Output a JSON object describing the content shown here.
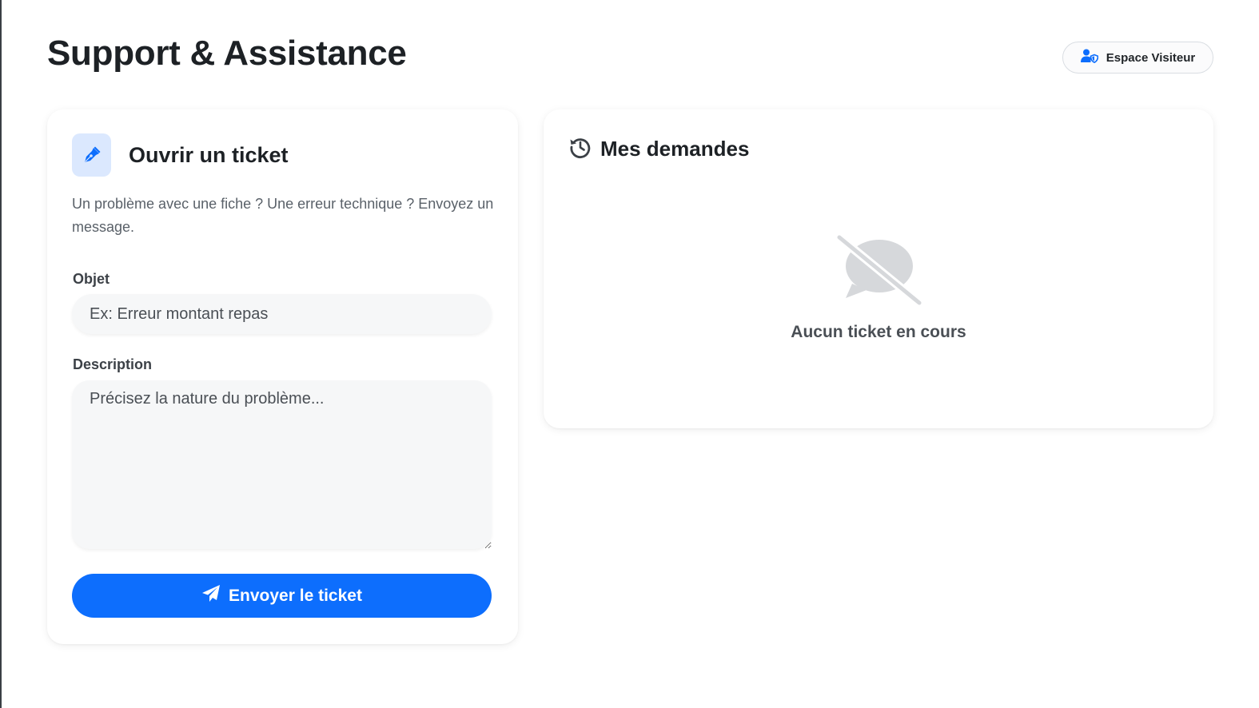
{
  "header": {
    "title": "Support & Assistance",
    "visitor_button": "Espace Visiteur"
  },
  "form": {
    "title": "Ouvrir un ticket",
    "description": "Un problème avec une fiche ? Une erreur technique ? Envoyez un message.",
    "subject_label": "Objet",
    "subject_placeholder": "Ex: Erreur montant repas",
    "subject_value": "",
    "description_label": "Description",
    "description_placeholder": "Précisez la nature du problème...",
    "description_value": "",
    "submit_label": "Envoyer le ticket"
  },
  "requests": {
    "title": "Mes demandes",
    "empty_text": "Aucun ticket en cours"
  },
  "colors": {
    "accent": "#0d6efd",
    "icon_bg": "#dbe8fe",
    "empty_icon": "#d6d8db"
  },
  "icons": {
    "visitor": "user-shield-icon",
    "form": "pen-nib-icon",
    "submit": "paper-plane-icon",
    "history": "history-icon",
    "empty": "comment-slash-icon"
  }
}
